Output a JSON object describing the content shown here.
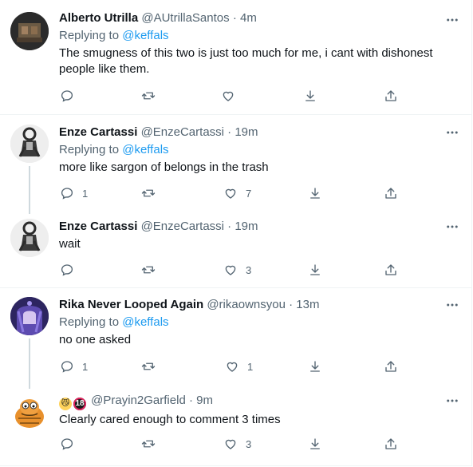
{
  "icons": {
    "more": "more-horizontal-icon",
    "reply": "reply-icon",
    "retweet": "retweet-icon",
    "like": "like-icon",
    "bookmark": "bookmark-icon",
    "share": "share-icon"
  },
  "colors": {
    "link": "#1d9bf0",
    "secondary": "#536471",
    "primary": "#0f1419",
    "thread_line": "#cfd9de"
  },
  "tweets": [
    {
      "name": "Alberto Utrilla",
      "handle": "@AUtrillaSantos",
      "dot": "·",
      "time": "4m",
      "replying_prefix": "Replying to",
      "replying_to": "@keffals",
      "text_line1": "The smugness of this two is just too much for me, i cant with dishonest",
      "text_line2": "people like them.",
      "reply_count": "",
      "retweet_count": "",
      "like_count": ""
    },
    {
      "name": "Enze Cartassi",
      "handle": "@EnzeCartassi",
      "dot": "·",
      "time": "19m",
      "replying_prefix": "Replying to",
      "replying_to": "@keffals",
      "text": "more like sargon of belongs in the trash",
      "reply_count": "1",
      "retweet_count": "",
      "like_count": "7"
    },
    {
      "name": "Enze Cartassi",
      "handle": "@EnzeCartassi",
      "dot": "·",
      "time": "19m",
      "text": "wait",
      "reply_count": "",
      "retweet_count": "",
      "like_count": "3"
    },
    {
      "name": "Rika Never Looped Again",
      "handle": "@rikaownsyou",
      "dot": "·",
      "time": "13m",
      "replying_prefix": "Replying to",
      "replying_to": "@keffals",
      "text": "no one asked",
      "reply_count": "1",
      "retweet_count": "",
      "like_count": "1"
    },
    {
      "name_emoji_1": "😼",
      "name_emoji_2": "18",
      "handle": "@Prayin2Garfield",
      "dot": "·",
      "time": "9m",
      "text": "Clearly cared enough to comment 3 times",
      "reply_count": "",
      "retweet_count": "",
      "like_count": "3"
    }
  ]
}
